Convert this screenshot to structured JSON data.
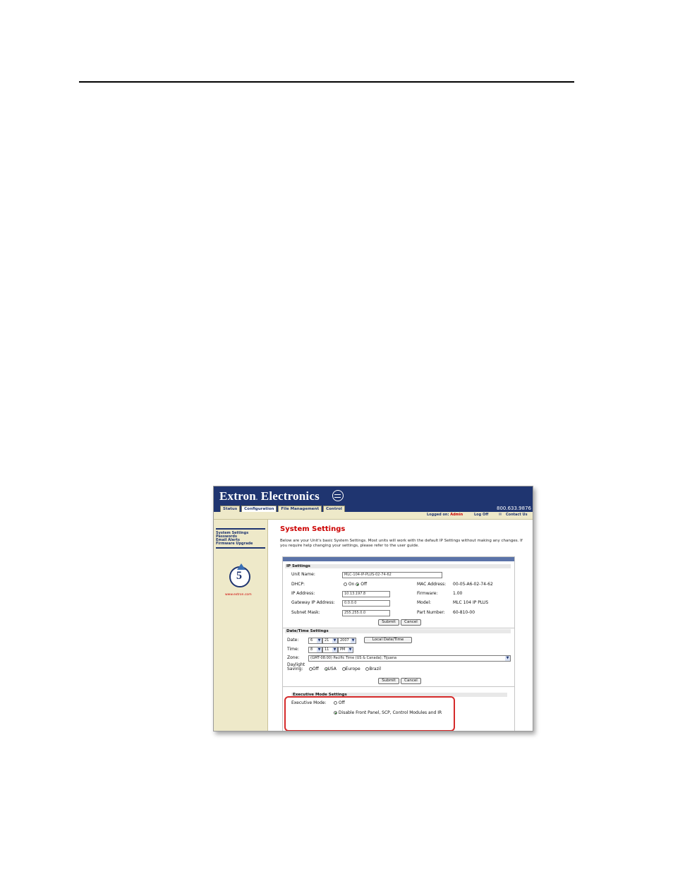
{
  "header": {
    "brand": "Extron",
    "brand_dot": ".",
    "brand_suffix": " Electronics",
    "phone": "800.633.9876",
    "tabs": [
      "Status",
      "Configuration",
      "File Management",
      "Control"
    ],
    "logged_on_label": "Logged on:",
    "logged_user": "Admin",
    "log_off": "Log Off",
    "contact": "Contact Us"
  },
  "sidebar": {
    "items": [
      {
        "label": "System Settings"
      },
      {
        "label": "Passwords"
      },
      {
        "label": "Email Alerts"
      },
      {
        "label": "Firmware Upgrade"
      }
    ],
    "badge_number": "5",
    "website": "www.extron.com"
  },
  "main": {
    "title": "System Settings",
    "intro": "Below are your Unit's basic System Settings. Most units will work with the default IP Settings without making any changes. If you require help changing your settings, please refer to the user guide."
  },
  "ip_settings": {
    "heading": "IP Settings",
    "unit_name_label": "Unit Name:",
    "unit_name_value": "MLC-104-IP-PLUS-02-74-62",
    "dhcp_label": "DHCP:",
    "dhcp_on": "On",
    "dhcp_off": "Off",
    "dhcp_selected": "Off",
    "ip_label": "IP Address:",
    "ip_value": "10.13.197.8",
    "gateway_label": "Gateway IP Address:",
    "gateway_value": "0.0.0.0",
    "subnet_label": "Subnet Mask:",
    "subnet_value": "255.255.0.0",
    "mac_label": "MAC Address:",
    "mac_value": "00-05-A6-02-74-62",
    "firmware_label": "Firmware:",
    "firmware_value": "1.00",
    "model_label": "Model:",
    "model_value": "MLC 104 IP PLUS",
    "part_label": "Part Number:",
    "part_value": "60-810-00",
    "submit": "Submit",
    "cancel": "Cancel"
  },
  "datetime": {
    "heading": "Date/Time Settings",
    "date_label": "Date:",
    "month": "6",
    "day": "21",
    "year": "2007",
    "local_button": "Local Date/Time",
    "time_label": "Time:",
    "hour": "8",
    "minute": "11",
    "ampm": "PM",
    "zone_label": "Zone:",
    "zone_value": "(GMT-08:00) Pacific Time (US & Canada); Tijuana",
    "daylight_label": "Daylight",
    "daylight_label2": "Saving:",
    "dst_options": [
      "Off",
      "USA",
      "Europe",
      "Brazil"
    ],
    "dst_selected": "USA",
    "submit": "Submit",
    "cancel": "Cancel"
  },
  "executive": {
    "heading": "Executive Mode Settings",
    "label": "Executive Mode:",
    "off": "Off",
    "option": "Disable Front Panel, SCP, Control Modules and IR",
    "selected": "Disable Front Panel, SCP, Control Modules and IR",
    "highlight_color": "#d52a2a"
  },
  "colors": {
    "header_blue": "#1f3570",
    "sidebar_beige": "#eee9c9",
    "title_red": "#cc0000"
  }
}
